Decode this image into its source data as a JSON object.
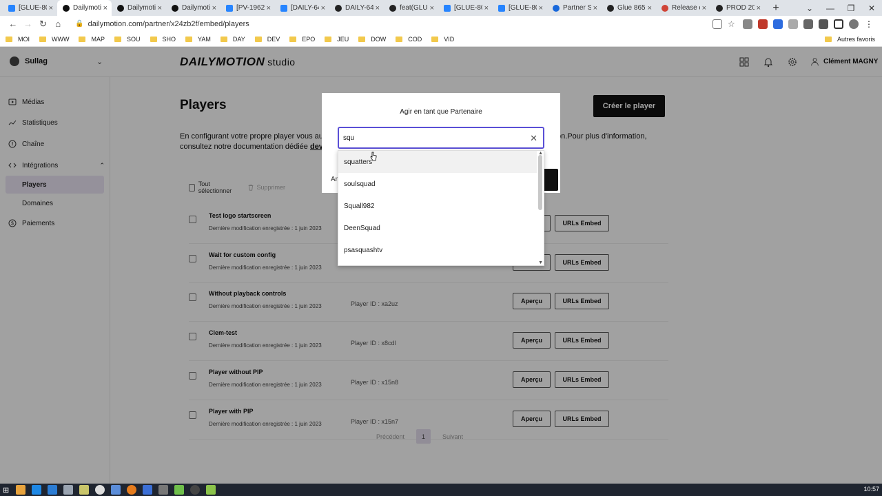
{
  "browser": {
    "tabs": [
      {
        "label": "[GLUE-80",
        "icon": "jira-icon",
        "active": false
      },
      {
        "label": "Dailymoti",
        "icon": "dailymotion-icon",
        "active": true
      },
      {
        "label": "Dailymoti",
        "icon": "dailymotion-icon",
        "active": false
      },
      {
        "label": "Dailymoti",
        "icon": "dailymotion-icon",
        "active": false
      },
      {
        "label": "[PV-1962",
        "icon": "jira-icon",
        "active": false
      },
      {
        "label": "[DAILY-64",
        "icon": "jira-icon",
        "active": false
      },
      {
        "label": "DAILY-64",
        "icon": "github-icon",
        "active": false
      },
      {
        "label": "feat(GLUE",
        "icon": "github-icon",
        "active": false
      },
      {
        "label": "[GLUE-80",
        "icon": "jira-icon",
        "active": false
      },
      {
        "label": "[GLUE-80",
        "icon": "jira-icon",
        "active": false
      },
      {
        "label": "Partner St",
        "icon": "confluence-icon",
        "active": false
      },
      {
        "label": "Glue 865",
        "icon": "github-icon",
        "active": false
      },
      {
        "label": "Release d",
        "icon": "release-icon",
        "active": false
      },
      {
        "label": "PROD 20",
        "icon": "github-icon",
        "active": false
      }
    ],
    "url": "dailymotion.com/partner/x24zb2f/embed/players",
    "bookmarks": [
      "MOI",
      "WWW",
      "MAP",
      "SOU",
      "SHO",
      "YAM",
      "DAY",
      "DEV",
      "EPO",
      "JEU",
      "DOW",
      "COD",
      "VID"
    ],
    "other_bookmarks": "Autres favoris"
  },
  "app": {
    "workspace": "Sullag",
    "logo_main": "DAILYMOTION",
    "logo_sub": "studio",
    "user_name": "Clément MAGNY",
    "sidebar": {
      "items": [
        {
          "label": "Médias",
          "icon": "media-icon"
        },
        {
          "label": "Statistiques",
          "icon": "stats-icon"
        },
        {
          "label": "Chaîne",
          "icon": "channel-icon"
        },
        {
          "label": "Intégrations",
          "icon": "code-icon"
        }
      ],
      "subitems": [
        {
          "label": "Players",
          "active": true
        },
        {
          "label": "Domaines",
          "active": false
        }
      ],
      "payments": "Paiements"
    },
    "main": {
      "title": "Players",
      "create_button": "Créer le player",
      "intro_line1_start": "En configurant votre propre player vous au",
      "intro_line1_end": "fusion.Pour plus d'information,",
      "intro_line2_start": "consultez notre documentation dédiée",
      "intro_link": "dev",
      "select_all": "Tout sélectionner",
      "delete": "Supprimer",
      "preview_label": "Aperçu",
      "embed_label": "URLs Embed",
      "players": [
        {
          "name": "Test logo startscreen",
          "modified": "Dernière modification enregistrée : 1 juin 2023",
          "player_id": ""
        },
        {
          "name": "Wait for custom config",
          "modified": "Dernière modification enregistrée : 1 juin 2023",
          "player_id": ""
        },
        {
          "name": "Without playback controls",
          "modified": "Dernière modification enregistrée : 1 juin 2023",
          "player_id": "Player ID : xa2uz"
        },
        {
          "name": "Clem-test",
          "modified": "Dernière modification enregistrée : 1 juin 2023",
          "player_id": "Player ID : x8cdl"
        },
        {
          "name": "Player without PIP",
          "modified": "Dernière modification enregistrée : 1 juin 2023",
          "player_id": "Player ID : x15n8"
        },
        {
          "name": "Player with PIP",
          "modified": "Dernière modification enregistrée : 1 juin 2023",
          "player_id": "Player ID : x15n7"
        }
      ],
      "pagination": {
        "prev": "Précédent",
        "page": "1",
        "next": "Suivant"
      }
    },
    "modal": {
      "title": "Agir en tant que Partenaire",
      "search_value": "squ",
      "cancel_partial": "An",
      "confirm_partial": "e",
      "options": [
        "squatters",
        "soulsquad",
        "Squall982",
        "DeenSquad",
        "psasquashtv"
      ]
    }
  },
  "taskbar": {
    "clock": "10:57"
  }
}
